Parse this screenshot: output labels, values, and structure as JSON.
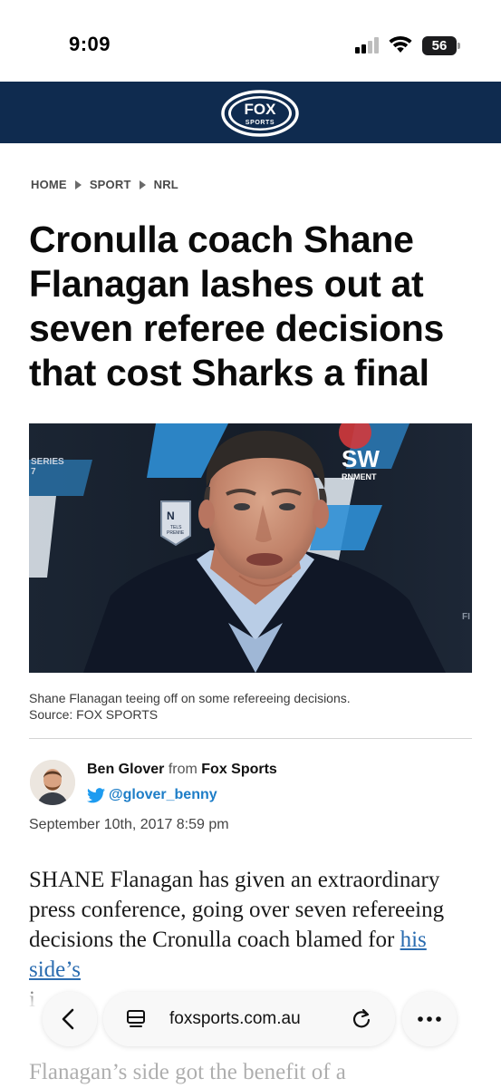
{
  "status_bar": {
    "time": "9:09",
    "battery_level": "56"
  },
  "header": {
    "logo_line1": "FOX",
    "logo_line2": "SPORTS"
  },
  "breadcrumb": [
    "HOME",
    "SPORT",
    "NRL"
  ],
  "article": {
    "headline": "Cronulla coach Shane Flanagan lashes out at seven referee decisions that cost Sharks a final",
    "image_caption_line1": "Shane Flanagan teeing off on some refereeing decisions.",
    "image_caption_line2": "Source: FOX SPORTS",
    "author_name": "Ben Glover",
    "author_from": "from",
    "author_org": "Fox Sports",
    "author_twitter": "@glover_benny",
    "date": "September 10th, 2017 8:59 pm",
    "para1_text": "SHANE Flanagan has given an extraordinary press conference, going over seven refereeing decisions the Cronulla coach blamed for ",
    "para1_link": "his side’s",
    "para1_partial": "i",
    "para2_text": "Flanagan’s side got the benefit of a"
  },
  "hero_image_text": {
    "series": "SERIES",
    "series_num": "7",
    "nsw": "SW",
    "govt": "RNMENT",
    "nrl": "N",
    "telstra": "TELS",
    "premier": "PREMIE",
    "fi": "FI"
  },
  "browser": {
    "url": "foxsports.com.au"
  },
  "colors": {
    "header_bg": "#0f2b4f",
    "link": "#2a6cb0",
    "twitter": "#1d7dc7"
  }
}
